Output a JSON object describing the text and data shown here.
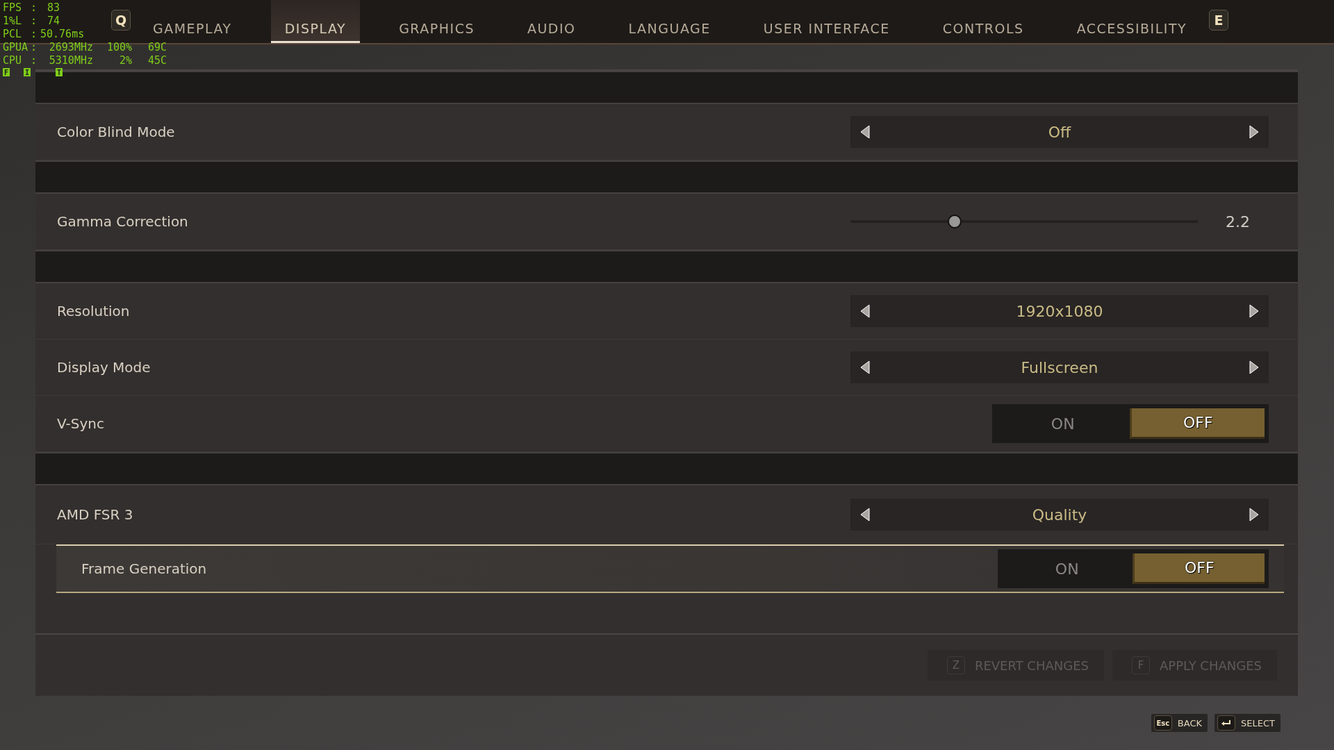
{
  "overlay": {
    "lines": [
      {
        "label": "FPS",
        "sep": ":",
        "values": [
          "83"
        ]
      },
      {
        "label": "1%L",
        "sep": ":",
        "values": [
          "74"
        ]
      },
      {
        "label": "PCL",
        "sep": ":",
        "values": [
          "50.76ms"
        ]
      },
      {
        "label": "GPUA",
        "sep": ":",
        "values": [
          "2693MHz",
          "100%",
          "69C"
        ]
      },
      {
        "label": "CPU",
        "sep": ":",
        "values": [
          "5310MHz",
          "2%",
          "45C"
        ]
      }
    ],
    "flags": [
      "F",
      "I",
      "T"
    ]
  },
  "tabs": {
    "prev_key": "Q",
    "next_key": "E",
    "items": [
      {
        "label": "GAMEPLAY",
        "selected": false
      },
      {
        "label": "DISPLAY",
        "selected": true
      },
      {
        "label": "GRAPHICS",
        "selected": false
      },
      {
        "label": "AUDIO",
        "selected": false
      },
      {
        "label": "LANGUAGE",
        "selected": false
      },
      {
        "label": "USER INTERFACE",
        "selected": false
      },
      {
        "label": "CONTROLS",
        "selected": false
      },
      {
        "label": "ACCESSIBILITY",
        "selected": false
      }
    ]
  },
  "groups": [
    {
      "rows": [
        {
          "kind": "selector",
          "label": "Color Blind Mode",
          "value": "Off",
          "selected": false
        }
      ]
    },
    {
      "rows": [
        {
          "kind": "slider",
          "label": "Gamma Correction",
          "level": 0.3,
          "value": "2.2",
          "selected": false
        }
      ]
    },
    {
      "rows": [
        {
          "kind": "selector",
          "label": "Resolution",
          "value": "1920x1080",
          "selected": false
        },
        {
          "kind": "selector",
          "label": "Display Mode",
          "value": "Fullscreen",
          "selected": false
        },
        {
          "kind": "toggle",
          "label": "V-Sync",
          "options": [
            {
              "label": "ON",
              "selected": false
            },
            {
              "label": "OFF",
              "selected": true
            }
          ],
          "selected": false
        }
      ]
    },
    {
      "rows": [
        {
          "kind": "selector",
          "label": "AMD FSR 3",
          "value": "Quality",
          "selected": false,
          "children": [
            {
              "kind": "toggle",
              "label": "Frame Generation",
              "options": [
                {
                  "label": "ON",
                  "selected": false
                },
                {
                  "label": "OFF",
                  "selected": true
                }
              ],
              "selected": true
            }
          ]
        }
      ]
    }
  ],
  "footer": {
    "buttons": [
      {
        "key": "Z",
        "label": "REVERT CHANGES",
        "disabled": true
      },
      {
        "key": "F",
        "label": "APPLY CHANGES",
        "disabled": true
      }
    ]
  },
  "hints": [
    {
      "kind": "esc",
      "key": "Esc",
      "label": "BACK"
    },
    {
      "kind": "enter",
      "label": "SELECT"
    }
  ]
}
